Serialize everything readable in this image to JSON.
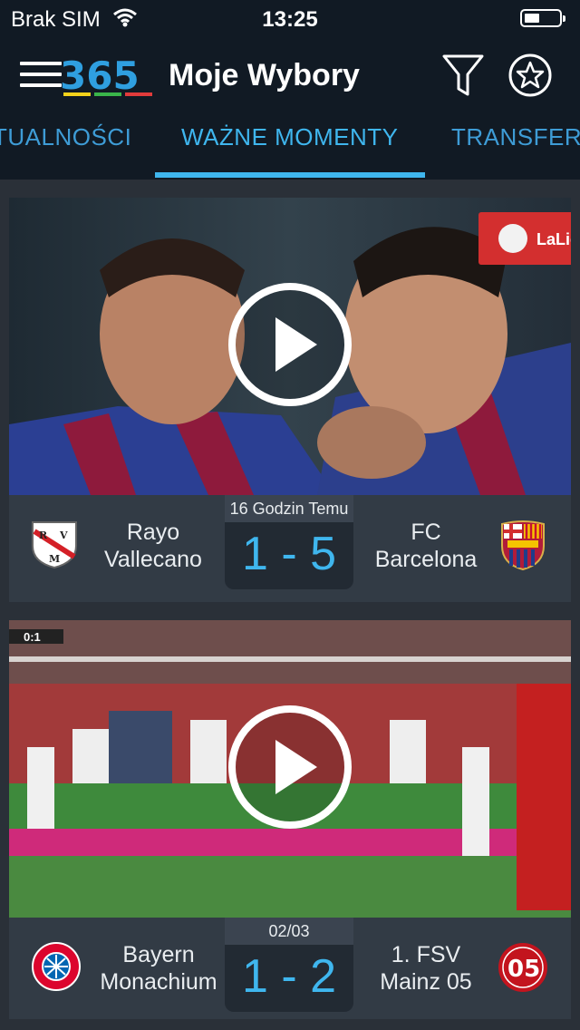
{
  "status_bar": {
    "carrier": "Brak SIM",
    "time": "13:25"
  },
  "header": {
    "title": "Moje Wybory",
    "logo_text": "365"
  },
  "tabs": [
    {
      "label": "AKTUALNOŚCI",
      "visible_text": "TUALNOŚCI"
    },
    {
      "label": "WAŻNE MOMENTY",
      "active": true
    },
    {
      "label": "TRANSFERY",
      "visible_text": "TRANSFER"
    }
  ],
  "highlights": [
    {
      "time_label": "16 Godzin Temu",
      "home_team": "Rayo Vallecano",
      "home_line1": "Rayo",
      "home_line2": "Vallecano",
      "away_team": "FC Barcelona",
      "away_line1": "FC",
      "away_line2": "Barcelona",
      "score": "1 - 5",
      "overlay_badge": "LaLiga"
    },
    {
      "time_label": "02/03",
      "home_team": "Bayern Monachium",
      "home_line1": "Bayern",
      "home_line2": "Monachium",
      "away_team": "1. FSV Mainz 05",
      "away_line1": "1. FSV",
      "away_line2": "Mainz 05",
      "score": "1 - 2",
      "scoreboard_overlay": "0:1"
    }
  ],
  "colors": {
    "accent": "#3fb6ee",
    "header_bg": "#111a24",
    "page_bg": "#2a3038"
  }
}
